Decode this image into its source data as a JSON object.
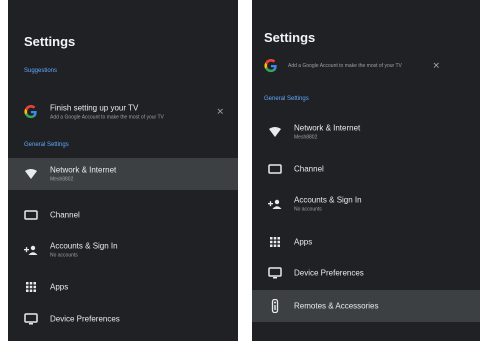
{
  "left": {
    "title": "Settings",
    "section_suggestions": "Suggestions",
    "suggestion": {
      "title": "Finish setting up your TV",
      "subtitle": "Add a Google Account to make the most of your TV",
      "close_glyph": "✕"
    },
    "section_general": "General Settings",
    "items": [
      {
        "label": "Network & Internet",
        "sub": "Mesh8802"
      },
      {
        "label": "Channel",
        "sub": ""
      },
      {
        "label": "Accounts & Sign In",
        "sub": "No accounts"
      },
      {
        "label": "Apps",
        "sub": ""
      },
      {
        "label": "Device Preferences",
        "sub": ""
      }
    ]
  },
  "right": {
    "title": "Settings",
    "suggestion": {
      "subtitle": "Add a Google Account to make the most of your TV",
      "close_glyph": "✕"
    },
    "section_general": "General Settings",
    "items": [
      {
        "label": "Network & Internet",
        "sub": "Mesh8802"
      },
      {
        "label": "Channel",
        "sub": ""
      },
      {
        "label": "Accounts & Sign In",
        "sub": "No accounts"
      },
      {
        "label": "Apps",
        "sub": ""
      },
      {
        "label": "Device Preferences",
        "sub": ""
      },
      {
        "label": "Remotes & Accessories",
        "sub": ""
      }
    ]
  }
}
